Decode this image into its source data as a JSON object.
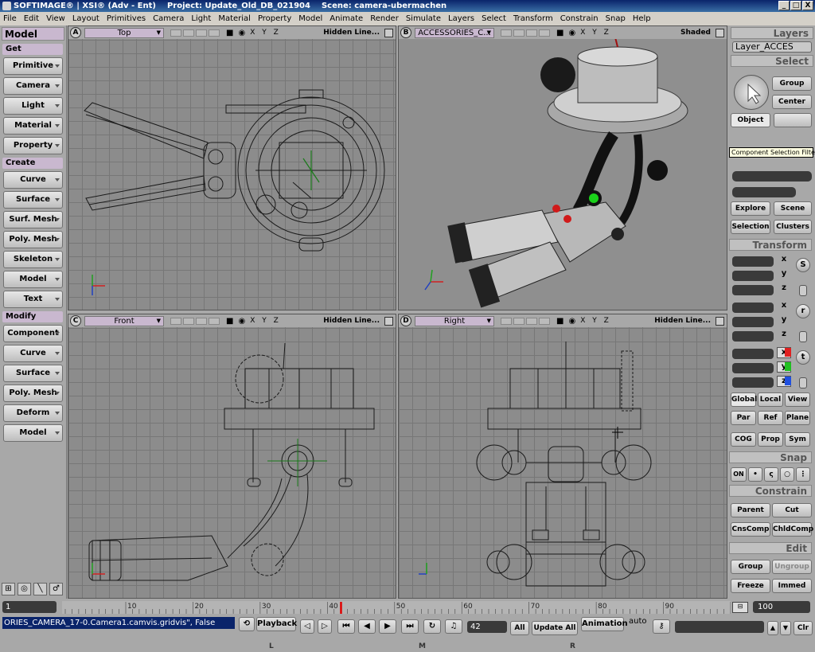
{
  "window": {
    "app": "SOFTIMAGE® | XSI® (Adv - Ent)",
    "project": "Project: Update_Old_DB_021904",
    "scene": "Scene: camera-ubermachen",
    "buttons": [
      "_",
      "□",
      "X"
    ]
  },
  "menu": [
    "File",
    "Edit",
    "View",
    "Layout",
    "Primitives",
    "Camera",
    "Light",
    "Material",
    "Property",
    "Model",
    "Animate",
    "Render",
    "Simulate",
    "Layers",
    "Select",
    "Transform",
    "Constrain",
    "Snap",
    "Help"
  ],
  "left": {
    "title": "Model",
    "get": {
      "label": "Get",
      "items": [
        "Primitive",
        "Camera",
        "Light",
        "Material",
        "Property"
      ]
    },
    "create": {
      "label": "Create",
      "items": [
        "Curve",
        "Surface",
        "Surf. Mesh",
        "Poly. Mesh",
        "Skeleton",
        "Model",
        "Text"
      ]
    },
    "modify": {
      "label": "Modify",
      "items": [
        "Component",
        "Curve",
        "Surface",
        "Poly. Mesh",
        "Deform",
        "Model"
      ]
    }
  },
  "viewports": {
    "a": {
      "letter": "A",
      "name": "Top",
      "mode": "Hidden Line..."
    },
    "b": {
      "letter": "B",
      "name": "ACCESSORIES_C...",
      "mode": "Shaded"
    },
    "c": {
      "letter": "C",
      "name": "Front",
      "mode": "Hidden Line..."
    },
    "d": {
      "letter": "D",
      "name": "Right",
      "mode": "Hidden Line..."
    },
    "xyz": "X Y Z"
  },
  "right": {
    "layers": {
      "title": "Layers",
      "current": "Layer_ACCES"
    },
    "select": {
      "title": "Select",
      "group": "Group",
      "center": "Center",
      "object": "Object",
      "tooltip": "Component Selection Filter",
      "explore": "Explore",
      "scene": "Scene",
      "selection": "Selection",
      "clusters": "Clusters"
    },
    "transform": {
      "title": "Transform",
      "s": "S",
      "r": "r",
      "t": "t",
      "x": "x",
      "y": "y",
      "z": "z",
      "global": "Global",
      "local": "Local",
      "view": "View",
      "par": "Par",
      "ref": "Ref",
      "plane": "Plane",
      "cog": "COG",
      "prop": "Prop",
      "sym": "Sym"
    },
    "snap": {
      "title": "Snap",
      "on": "ON"
    },
    "constrain": {
      "title": "Constrain",
      "parent": "Parent",
      "cut": "Cut",
      "cnscomp": "CnsComp",
      "chldcomp": "ChldComp"
    },
    "edit": {
      "title": "Edit",
      "group": "Group",
      "ungroup": "Ungroup",
      "freeze": "Freeze",
      "immed": "Immed"
    }
  },
  "timeline": {
    "start": "1",
    "end": "100",
    "ticks": [
      "10",
      "20",
      "30",
      "40",
      "50",
      "60",
      "70",
      "80",
      "90"
    ]
  },
  "bottom": {
    "command": "ORIES_CAMERA_17-0.Camera1.camvis.gridvis\", False",
    "playback": "Playback",
    "frame": "42",
    "all": "All",
    "update_all": "Update All",
    "animation": "Animation",
    "auto": "auto",
    "clr": "Clr",
    "mouse": {
      "l": "L",
      "m": "M",
      "r": "R"
    }
  }
}
